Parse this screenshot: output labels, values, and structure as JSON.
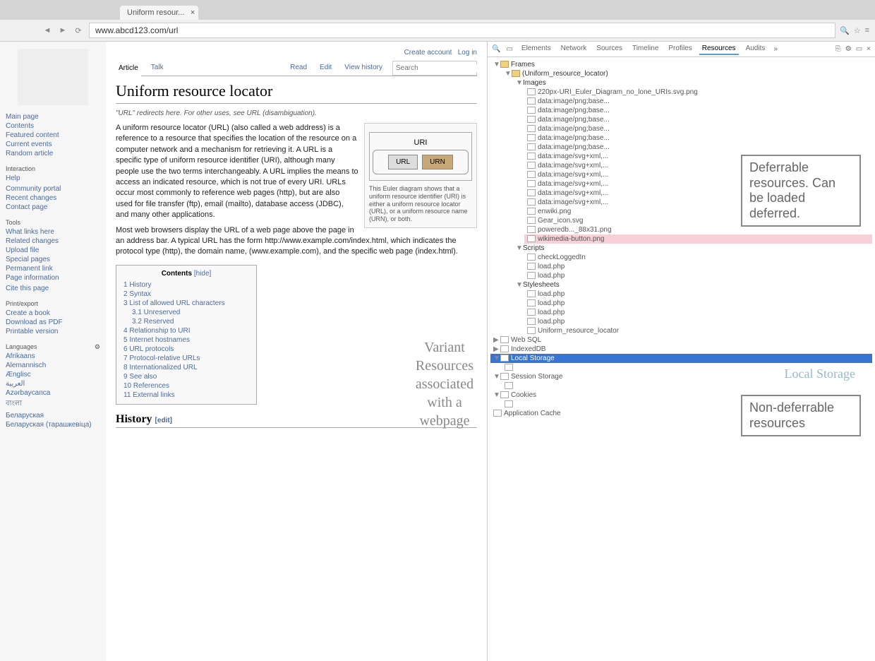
{
  "browser": {
    "tab_title": "Uniform resour...",
    "url": "www.abcd123.com/url"
  },
  "wiki": {
    "top_links": {
      "create": "Create account",
      "login": "Log in"
    },
    "tabs_left": [
      "Article",
      "Talk"
    ],
    "tabs_right": [
      "Read",
      "Edit",
      "View history"
    ],
    "search_placeholder": "Search",
    "title": "Uniform resource locator",
    "redirect": "\"URL\" redirects here. For other uses, see URL (disambiguation).",
    "para1": "A uniform resource locator (URL) (also called a web address) is a reference to a resource that specifies the location of the resource on a computer network and a mechanism for retrieving it. A URL is a specific type of uniform resource identifier (URI), although many people use the two terms interchangeably. A URL implies the means to access an indicated resource, which is not true of every URI. URLs occur most commonly to reference web pages (http), but are also used for file transfer (ftp), email (mailto), database access (JDBC), and many other applications.",
    "para2": "Most web browsers display the URL of a web page above the page in an address bar. A typical URL has the form http://www.example.com/index.html, which indicates the protocol type (http), the domain name, (www.example.com), and the specific web page (index.html).",
    "infobox": {
      "top": "URI",
      "left": "URL",
      "right": "URN",
      "caption": "This Euler diagram shows that a uniform resource identifier (URI) is either a uniform resource locator (URL), or a uniform resource name (URN), or both."
    },
    "toc_title": "Contents",
    "toc_hide": "[hide]",
    "toc": [
      {
        "n": "1",
        "t": "History"
      },
      {
        "n": "2",
        "t": "Syntax"
      },
      {
        "n": "3",
        "t": "List of allowed URL characters"
      },
      {
        "n": "3.1",
        "t": "Unreserved",
        "sub": true
      },
      {
        "n": "3.2",
        "t": "Reserved",
        "sub": true
      },
      {
        "n": "4",
        "t": "Relationship to URI"
      },
      {
        "n": "5",
        "t": "Internet hostnames"
      },
      {
        "n": "6",
        "t": "URL protocols"
      },
      {
        "n": "7",
        "t": "Protocol-relative URLs"
      },
      {
        "n": "8",
        "t": "Internationalized URL"
      },
      {
        "n": "9",
        "t": "See also"
      },
      {
        "n": "10",
        "t": "References"
      },
      {
        "n": "11",
        "t": "External links"
      }
    ],
    "section_history": "History",
    "edit_label": "[edit]",
    "sidebar": {
      "nav": [
        "Main page",
        "Contents",
        "Featured content",
        "Current events",
        "Random article"
      ],
      "interaction_h": "Interaction",
      "interaction": [
        "Help",
        "",
        "Community portal",
        "Recent changes",
        "Contact page"
      ],
      "tools_h": "Tools",
      "tools": [
        "What links here",
        "Related changes",
        "Upload file",
        "Special pages",
        "Permanent link",
        "Page information",
        "",
        "Cite this page"
      ],
      "print_h": "Print/export",
      "print": [
        "Create a book",
        "Download as PDF",
        "Printable version"
      ],
      "lang_h": "Languages",
      "lang": [
        "Afrikaans",
        "Alemannisch",
        "Ænglisc",
        "العربية",
        "Azərbaycanca",
        "বাংলা",
        "Беларуская",
        "Беларуская (тарашкевіца)"
      ]
    }
  },
  "devtools": {
    "tabs": [
      "Elements",
      "Network",
      "Sources",
      "Timeline",
      "Profiles",
      "Resources",
      "Audits"
    ],
    "active_tab": "Resources",
    "frames_label": "Frames",
    "frame_name": "(Uniform_resource_locator)",
    "images_label": "Images",
    "images": [
      "220px-URI_Euler_Diagram_no_lone_URIs.svg.png",
      "data:image/png;base...",
      "data:image/png;base...",
      "data:image/png;base...",
      "data:image/png;base...",
      "data:image/png;base...",
      "data:image/png;base...",
      "data:image/svg+xml,...",
      "data:image/svg+xml,...",
      "data:image/svg+xml,...",
      "data:image/svg+xml,...",
      "data:image/svg+xml,...",
      "data:image/svg+xml,...",
      "enwiki.png",
      "Gear_icon.svg",
      "poweredb..._88x31.png",
      "wikimedia-button.png"
    ],
    "scripts_label": "Scripts",
    "scripts": [
      "checkLoggedIn",
      "load.php",
      "load.php"
    ],
    "styles_label": "Stylesheets",
    "styles": [
      "load.php",
      "load.php",
      "load.php",
      "load.php",
      "Uniform_resource_locator"
    ],
    "storage": {
      "websql": "Web SQL",
      "indexed": "IndexedDB",
      "local": "Local Storage",
      "session": "Session Storage",
      "cookies": "Cookies",
      "appcache": "Application Cache"
    }
  },
  "annotations": {
    "variant": "Variant Resources associated with a webpage",
    "deferrable": "Deferrable resources. Can be loaded deferred.",
    "nondeferrable": "Non-deferrable resources",
    "local_storage": "Local Storage"
  }
}
